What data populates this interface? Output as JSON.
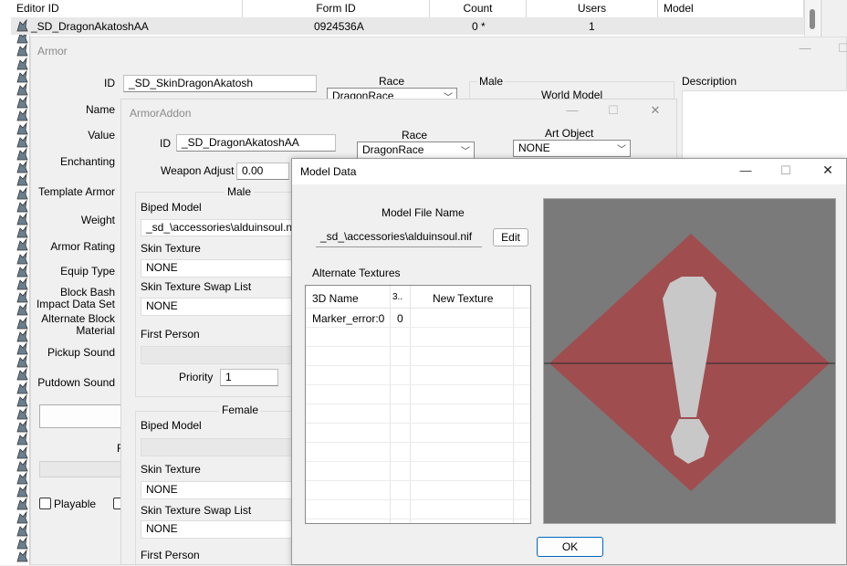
{
  "list_header": {
    "col_editor_id": "Editor ID",
    "col_form_id": "Form ID",
    "col_count": "Count",
    "col_users": "Users",
    "col_model": "Model"
  },
  "list_row": {
    "editor_id": "_SD_DragonAkatoshAA",
    "form_id": "0924536A",
    "count": "0 *",
    "users": "1"
  },
  "armor_window": {
    "title": "Armor",
    "id_label": "ID",
    "id_value": "_SD_SkinDragonAkatosh",
    "race_label": "Race",
    "race_value": "DragonRace",
    "male_label": "Male",
    "world_model_label": "World Model",
    "description_label": "Description",
    "labels": {
      "name": "Name",
      "value": "Value",
      "enchanting": "Enchanting",
      "template_armor": "Template Armor",
      "weight": "Weight",
      "armor_rating": "Armor Rating",
      "equip_type": "Equip Type",
      "block_bash": "Block Bash",
      "impact_data_set": "Impact Data Set",
      "alternate_block": "Alternate Block",
      "material": "Material",
      "pickup_sound": "Pickup Sound",
      "putdown_sound": "Putdown Sound",
      "playable": "Playable",
      "partial_letter": "F"
    }
  },
  "armoraddon_window": {
    "title": "ArmorAddon",
    "id_label": "ID",
    "id_value": "_SD_DragonAkatoshAA",
    "race_label": "Race",
    "race_value": "DragonRace",
    "art_object_label": "Art Object",
    "art_object_value": "NONE",
    "weapon_adjust_label": "Weapon Adjust",
    "weapon_adjust_value": "0.00",
    "male_label": "Male",
    "female_label": "Female",
    "biped_model_label": "Biped Model",
    "male_biped_model_value": "_sd_\\accessories\\alduinsoul.nif",
    "skin_texture_label": "Skin Texture",
    "skin_texture_value": "NONE",
    "skin_swap_label": "Skin Texture Swap List",
    "skin_swap_value": "NONE",
    "first_person_label": "First Person",
    "priority_label": "Priority",
    "priority_value": "1",
    "female_skin_texture_value": "NONE",
    "female_skin_swap_value": "NONE"
  },
  "model_data_window": {
    "title": "Model Data",
    "model_file_label": "Model File Name",
    "model_file_value": "_sd_\\accessories\\alduinsoul.nif",
    "edit_button": "Edit",
    "alt_textures_label": "Alternate Textures",
    "table_headers": {
      "name": "3D Name",
      "index": "3..",
      "texture": "New Texture"
    },
    "table_rows": [
      {
        "name": "Marker_error:0",
        "index": "0",
        "texture": ""
      }
    ],
    "ok_button": "OK"
  },
  "window_controls": {
    "minimize": "—",
    "maximize": "☐",
    "close": "✕"
  },
  "colors": {
    "preview_bg": "#7a7a7a",
    "diamond": "#a04d4f",
    "marker": "#c8c8c8"
  },
  "icons": {
    "row_icon": "dragon-icon"
  }
}
